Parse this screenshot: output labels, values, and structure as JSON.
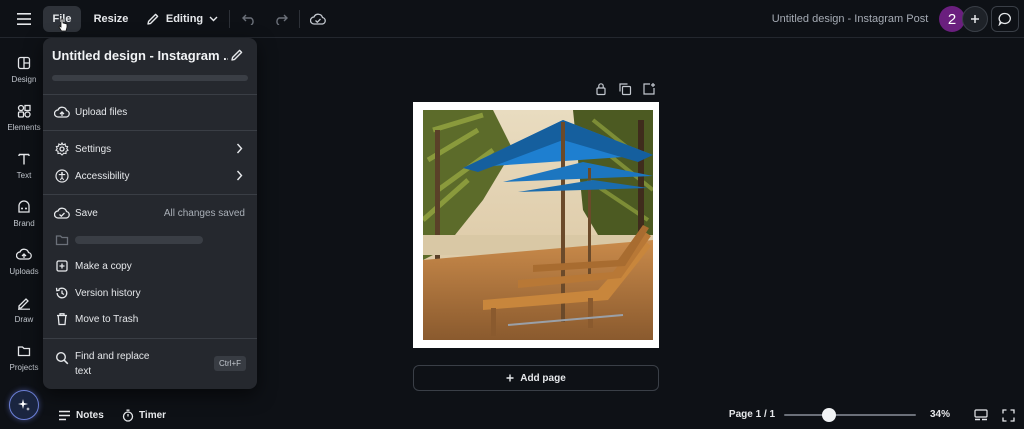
{
  "topbar": {
    "file_label": "File",
    "resize_label": "Resize",
    "editing_label": "Editing",
    "doc_title": "Untitled design - Instagram Post",
    "avatar_text": "2",
    "avatar_color": "#6a1f7e"
  },
  "rail": {
    "items": [
      {
        "label": "Design",
        "icon": "design-icon"
      },
      {
        "label": "Elements",
        "icon": "elements-icon"
      },
      {
        "label": "Text",
        "icon": "text-icon"
      },
      {
        "label": "Brand",
        "icon": "brand-icon"
      },
      {
        "label": "Uploads",
        "icon": "uploads-icon"
      },
      {
        "label": "Draw",
        "icon": "draw-icon"
      },
      {
        "label": "Projects",
        "icon": "projects-icon"
      }
    ]
  },
  "file_menu": {
    "title": "Untitled design - Instagram ...",
    "upload_files": "Upload files",
    "settings": "Settings",
    "accessibility": "Accessibility",
    "save": "Save",
    "save_status": "All changes saved",
    "make_copy": "Make a copy",
    "version_history": "Version history",
    "move_to_trash": "Move to Trash",
    "find_replace": "Find and replace text",
    "find_replace_line1": "Find and replace",
    "find_replace_line2": "text",
    "find_replace_shortcut": "Ctrl+F"
  },
  "canvas": {
    "add_page_label": "Add page"
  },
  "bottombar": {
    "notes_label": "Notes",
    "timer_label": "Timer",
    "page_count": "Page 1 / 1",
    "zoom": "34%",
    "zoom_level": 0.34
  },
  "colors": {
    "background": "#0e1116",
    "menu": "#25282e",
    "accent_magic": "#6b7fd6",
    "umbrella": "#1e7fd0"
  }
}
